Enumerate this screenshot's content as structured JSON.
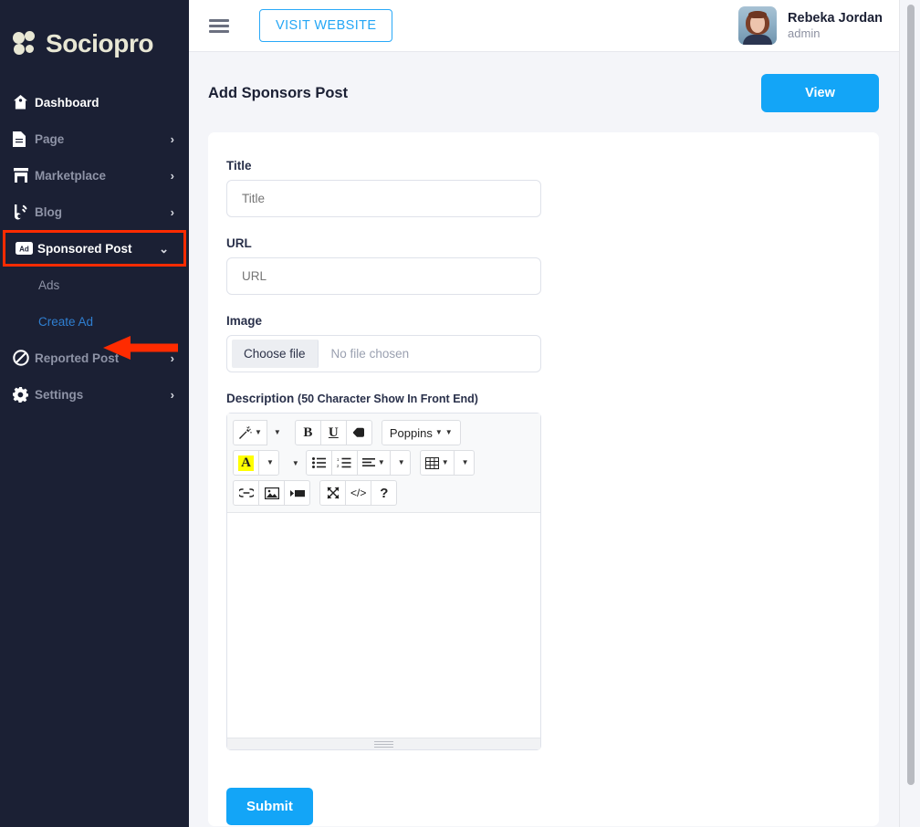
{
  "brand": {
    "name": "Sociopro"
  },
  "sidebar": {
    "items": [
      {
        "label": "Dashboard",
        "icon": "home-icon",
        "active": true,
        "caret": ""
      },
      {
        "label": "Page",
        "icon": "file-icon",
        "active": false,
        "caret": "›"
      },
      {
        "label": "Marketplace",
        "icon": "store-icon",
        "active": false,
        "caret": "›"
      },
      {
        "label": "Blog",
        "icon": "blog-icon",
        "active": false,
        "caret": "›"
      },
      {
        "label": "Sponsored Post",
        "icon": "ad-icon",
        "active": true,
        "caret": "⌄",
        "highlighted": true
      },
      {
        "label": "Reported Post",
        "icon": "block-icon",
        "active": false,
        "caret": "›"
      },
      {
        "label": "Settings",
        "icon": "gear-icon",
        "active": false,
        "caret": "›"
      }
    ],
    "sub_items": [
      {
        "label": "Ads",
        "highlight": false
      },
      {
        "label": "Create Ad",
        "highlight": true
      }
    ],
    "annotation_color": "#ff2b00"
  },
  "topbar": {
    "menu_icon": "hamburger-icon",
    "visit_label": "VISIT WEBSITE",
    "user": {
      "name": "Rebeka Jordan",
      "role": "admin",
      "avatar": "user-avatar"
    }
  },
  "page": {
    "title": "Add Sponsors Post",
    "view_label": "View",
    "accent": "#13a5f7"
  },
  "form": {
    "title_label": "Title",
    "title_placeholder": "Title",
    "title_value": "",
    "url_label": "URL",
    "url_placeholder": "URL",
    "url_value": "",
    "image_label": "Image",
    "choose_file_label": "Choose file",
    "file_status": "No file chosen",
    "description_label": "Description",
    "description_hint": "(50 Character Show In Front End)",
    "description_value": "",
    "submit_label": "Submit"
  },
  "editor": {
    "font_name": "Poppins",
    "toolbar": {
      "row1": [
        "magic-wand-icon",
        "bold-icon",
        "underline-icon",
        "eraser-icon",
        "font-family-select"
      ],
      "row2": [
        "text-highlight-icon",
        "bullet-list-icon",
        "numbered-list-icon",
        "align-icon",
        "table-icon"
      ],
      "row3": [
        "link-icon",
        "image-icon",
        "video-icon",
        "fullscreen-icon",
        "code-view-icon",
        "help-icon"
      ]
    },
    "bold_glyph": "B",
    "underline_glyph": "U",
    "highlight_glyph": "A",
    "code_glyph": "</>",
    "help_glyph": "?"
  }
}
